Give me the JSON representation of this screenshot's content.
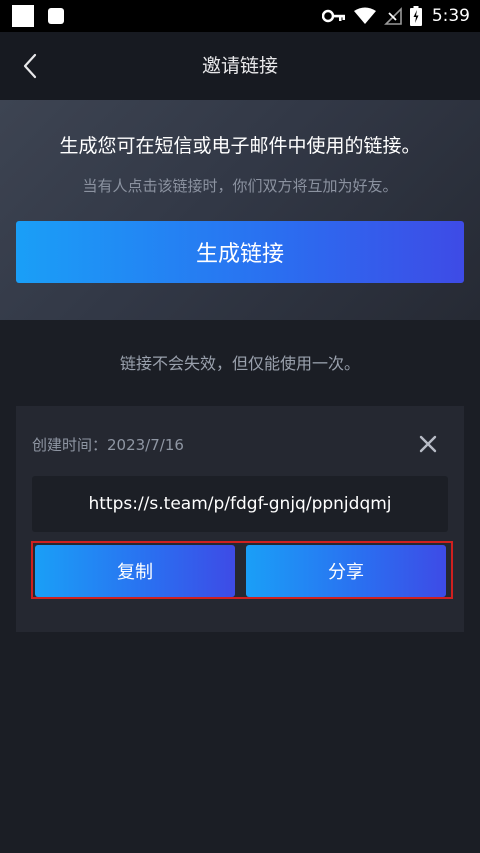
{
  "status_bar": {
    "time": "5:39",
    "icons": [
      "app-square-icon",
      "notification-icon",
      "key-icon",
      "wifi-icon",
      "no-signal-icon",
      "battery-icon"
    ]
  },
  "header": {
    "title": "邀请链接",
    "back_icon": "chevron-left-icon"
  },
  "generate": {
    "title": "生成您可在短信或电子邮件中使用的链接。",
    "subtitle": "当有人点击该链接时，你们双方将互加为好友。",
    "button_label": "生成链接"
  },
  "note": "链接不会失效，但仅能使用一次。",
  "link_card": {
    "created_label": "创建时间：2023/7/16",
    "url": "https://s.team/p/fdgf-gnjq/ppnjdqmj",
    "copy_label": "复制",
    "share_label": "分享"
  },
  "colors": {
    "accent_start": "#1a9ff7",
    "accent_end": "#3e4be6",
    "highlight_border": "#d0201f",
    "background": "#1b1e25"
  }
}
